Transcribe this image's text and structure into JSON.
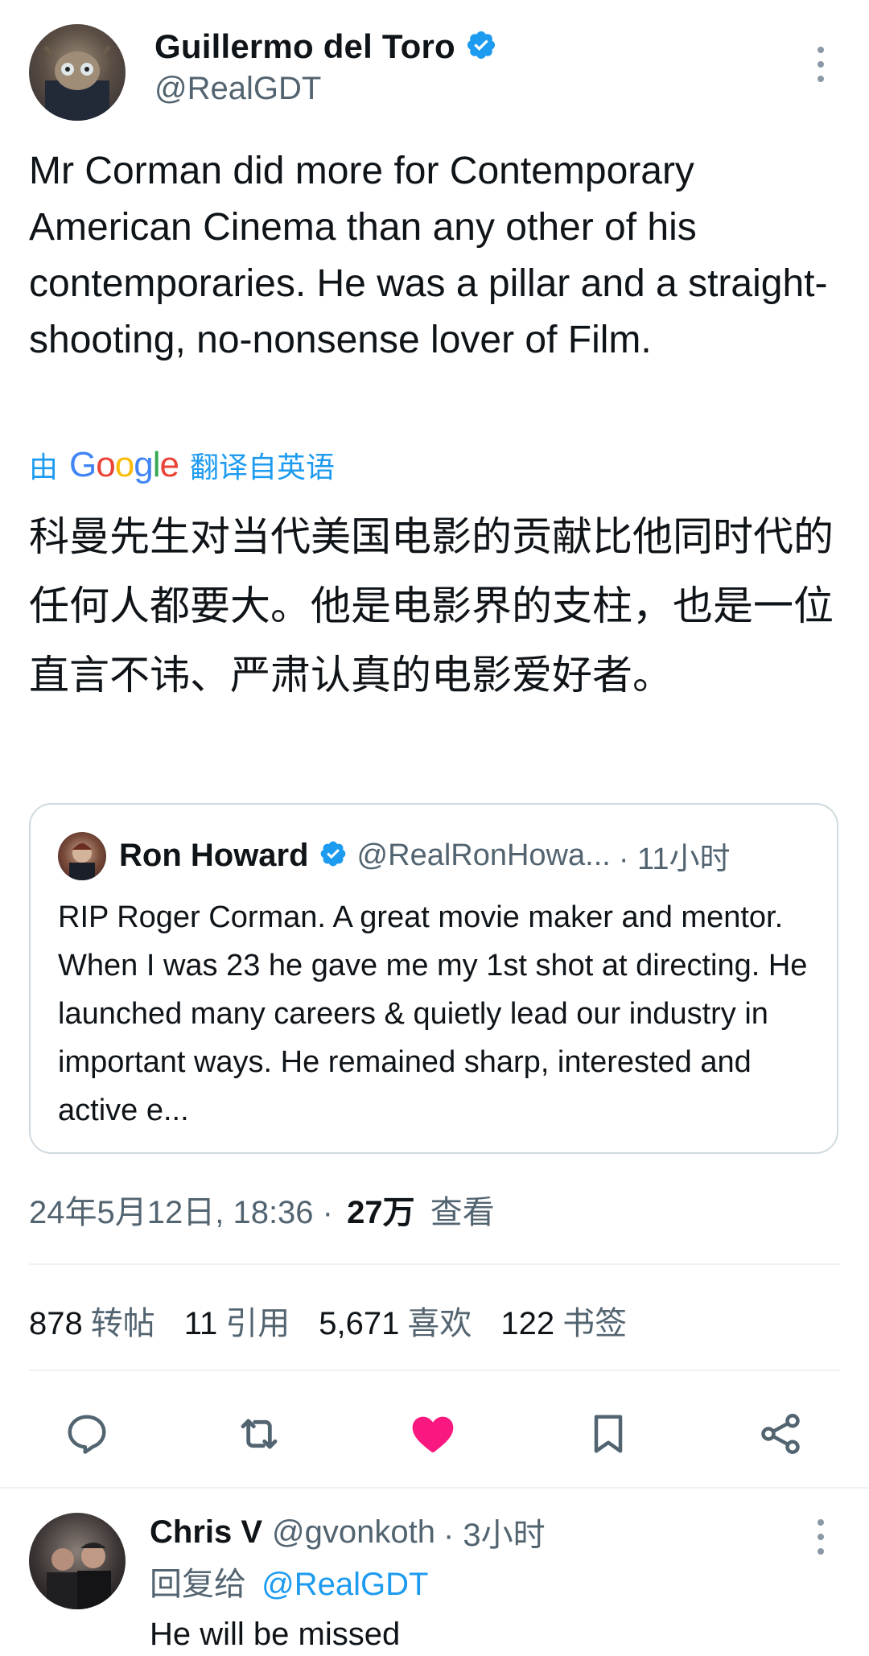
{
  "tweet": {
    "author_name": "Guillermo del Toro",
    "author_handle": "@RealGDT",
    "text": "Mr Corman did more for Contemporary American Cinema than any other of his contemporaries.  He was a pillar and a straight-shooting, no-nonsense lover of Film.",
    "translate_prefix": "由",
    "translate_brand": [
      "G",
      "o",
      "o",
      "g",
      "l",
      "e"
    ],
    "translate_suffix": "翻译自英语",
    "translation": "科曼先生对当代美国电影的贡献比他同时代的任何人都要大。他是电影界的支柱，也是一位直言不讳、严肃认真的电影爱好者。",
    "timestamp": "24年5月12日, 18:36 ·",
    "views_count": "27万",
    "views_label": "查看"
  },
  "quote": {
    "author_name": "Ron Howard",
    "author_handle": "@RealRonHowa...",
    "time": "· 11小时",
    "text": "RIP Roger Corman. A great movie maker and mentor.  When I was 23 he gave me my 1st shot at directing. He launched many careers & quietly lead our industry in important ways. He remained sharp, interested and active e..."
  },
  "stats": [
    {
      "value": "878",
      "label": "转帖"
    },
    {
      "value": "11",
      "label": "引用"
    },
    {
      "value": "5,671",
      "label": "喜欢"
    },
    {
      "value": "122",
      "label": "书签"
    }
  ],
  "actions": [
    "reply-icon",
    "retweet-icon",
    "like-icon",
    "bookmark-icon",
    "share-icon"
  ],
  "reply": {
    "author_name": "Chris V",
    "author_handle": "@gvonkoth",
    "time": "· 3小时",
    "reply_to_prefix": "回复给",
    "reply_to_handle": "@RealGDT",
    "text": "He will be missed"
  },
  "colors": {
    "verified": "#1d9bf0",
    "link": "#1d9bf0",
    "like": "#f91880",
    "google_blue": "#4285f4",
    "google_red": "#ea4335",
    "google_yellow": "#fbbc05",
    "google_green": "#34a853"
  }
}
